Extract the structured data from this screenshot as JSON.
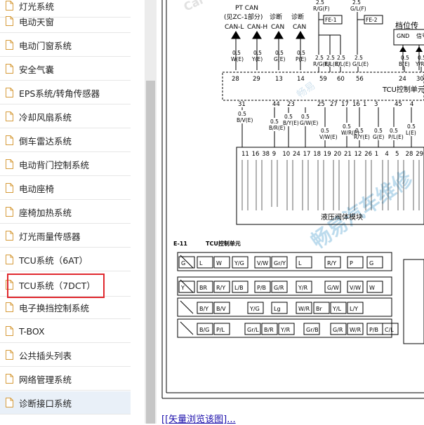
{
  "sidebar": {
    "items": [
      {
        "label": "灯光系统"
      },
      {
        "label": "电动天窗"
      },
      {
        "label": "电动门窗系统"
      },
      {
        "label": "安全气囊"
      },
      {
        "label": "EPS系统/转角传感器"
      },
      {
        "label": "冷却风扇系统"
      },
      {
        "label": "倒车雷达系统"
      },
      {
        "label": "电动背门控制系统"
      },
      {
        "label": "电动座椅"
      },
      {
        "label": "座椅加热系统"
      },
      {
        "label": "灯光雨量传感器"
      },
      {
        "label": "TCU系统（6AT）"
      },
      {
        "label": "TCU系统（7DCT）"
      },
      {
        "label": "电子换挡控制系统"
      },
      {
        "label": "T-BOX"
      },
      {
        "label": "公共插头列表"
      },
      {
        "label": "网络管理系统"
      },
      {
        "label": "诊断接口系统"
      }
    ],
    "selected_index": 12,
    "hover_index": 17
  },
  "diagram": {
    "top_labels": {
      "pt_can": "PT CAN",
      "zc_ref": "(见ZC-1部分)",
      "can_l": "CAN-L",
      "can_h": "CAN-H",
      "diag_can1": "诊断",
      "diag_can1_b": "CAN",
      "diag_can2": "诊断",
      "diag_can2_b": "CAN",
      "fe1": "FE-1",
      "fe2": "FE-2",
      "gear_pos": "档位传",
      "gnd": "GND",
      "sig": "信号"
    },
    "wires_top": [
      {
        "size": "0.5",
        "color": "W(E)"
      },
      {
        "size": "0.5",
        "color": "Y(E)"
      },
      {
        "size": "0.5",
        "color": "G(E)"
      },
      {
        "size": "0.5",
        "color": "P(E)"
      }
    ],
    "fuse_wires": [
      {
        "size": "2.5",
        "color": "R/G(F)"
      },
      {
        "size": "2.5",
        "color": "G/L(F)"
      }
    ],
    "mid_wires": [
      {
        "size": "2.5",
        "color": "R/G(E)"
      },
      {
        "size": "2.5",
        "color": "R/L(E)"
      },
      {
        "size": "2.5",
        "color": "R/L(E)"
      },
      {
        "size": "2.5",
        "color": "G/L(E)"
      },
      {
        "size": "0.5",
        "color": "B(E)"
      },
      {
        "size": "0.5",
        "color": "Y/R"
      }
    ],
    "top_pins": [
      "28",
      "29",
      "13",
      "14",
      "59",
      "60",
      "56",
      "24",
      "30"
    ],
    "tcu_label": "TCU控制单元",
    "bottom_pins": [
      "31",
      "44",
      "23",
      "25",
      "27",
      "17",
      "16",
      "1",
      "3",
      "45",
      "4"
    ],
    "bottom_wires": [
      {
        "size": "0.5",
        "color": "B/V(E)"
      },
      {
        "size": "0.5",
        "color": "B/R(E)"
      },
      {
        "size": "0.5",
        "color": "B/Y(E)"
      },
      {
        "size": "0.5",
        "color": "G/W(E)"
      },
      {
        "size": "0.5",
        "color": "V/W(E)"
      },
      {
        "size": "0.5",
        "color": "W/R(E)"
      },
      {
        "size": "0.5",
        "color": "R/Y(E)"
      },
      {
        "size": "0.5",
        "color": "G(E)"
      },
      {
        "size": "0.5",
        "color": "P/L(E)"
      },
      {
        "size": "0.5",
        "color": "L(E)"
      }
    ],
    "module_pins": [
      "11",
      "16",
      "38",
      "9",
      "10",
      "24",
      "17",
      "18",
      "19",
      "20",
      "21",
      "12",
      "26",
      "1",
      "4",
      "5",
      "28",
      "29"
    ],
    "module_label": "液压阀体模块",
    "connector_id": "E-11",
    "connector_title": "TCU控制单元",
    "connector_rows": [
      [
        "G",
        "L",
        "W",
        "Y/G",
        "V/W",
        "Gr/Y",
        "L",
        "R/Y",
        "P",
        "G"
      ],
      [
        "Y",
        "BR",
        "R/Y",
        "L/B",
        "P/B",
        "G/R",
        "Y/R",
        "G/W",
        "V/W",
        "W"
      ],
      [
        "B/Y",
        "B/V",
        "Y/G",
        "Lg",
        "W/R",
        "Br",
        "Y/L",
        "L/Y"
      ],
      [
        "B/G",
        "P/L",
        "Gr/L",
        "B/R",
        "Y/R",
        "Gr/B",
        "G/R",
        "W/R",
        "P/B",
        "C/L"
      ]
    ],
    "watermarks": [
      "畅易",
      "畅易汽车维修",
      "Car"
    ]
  },
  "bottom_link": {
    "prefix": "[",
    "text": "[矢量浏览该图]",
    "suffix": "..."
  },
  "colors": {
    "selected_border": "#e0282e",
    "hover_bg": "#e9f0f8",
    "link": "#1a0dab",
    "doc_icon": "#d69b3a",
    "watermark": "#6aaed6"
  }
}
